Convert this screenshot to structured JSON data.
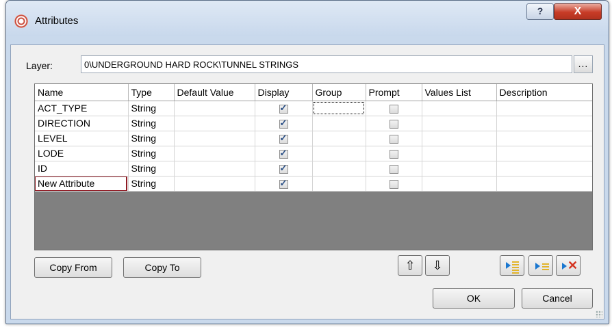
{
  "window": {
    "title": "Attributes",
    "help_label": "?",
    "close_label": "X"
  },
  "layer": {
    "label": "Layer:",
    "value": "0\\UNDERGROUND HARD ROCK\\TUNNEL STRINGS",
    "browse_label": "..."
  },
  "table": {
    "columns": [
      "Name",
      "Type",
      "Default Value",
      "Display",
      "Group",
      "Prompt",
      "Values List",
      "Description"
    ],
    "rows": [
      {
        "name": "ACT_TYPE",
        "type": "String",
        "default": "",
        "display": true,
        "group": "",
        "prompt": false,
        "values_list": "",
        "description": ""
      },
      {
        "name": "DIRECTION",
        "type": "String",
        "default": "",
        "display": true,
        "group": "",
        "prompt": false,
        "values_list": "",
        "description": ""
      },
      {
        "name": "LEVEL",
        "type": "String",
        "default": "",
        "display": true,
        "group": "",
        "prompt": false,
        "values_list": "",
        "description": ""
      },
      {
        "name": "LODE",
        "type": "String",
        "default": "",
        "display": true,
        "group": "",
        "prompt": false,
        "values_list": "",
        "description": ""
      },
      {
        "name": "ID",
        "type": "String",
        "default": "",
        "display": true,
        "group": "",
        "prompt": false,
        "values_list": "",
        "description": ""
      },
      {
        "name": "New Attribute",
        "type": "String",
        "default": "",
        "display": true,
        "group": "",
        "prompt": false,
        "values_list": "",
        "description": ""
      }
    ]
  },
  "buttons": {
    "copy_from": "Copy From",
    "copy_to": "Copy To",
    "move_up": "⇧",
    "move_down": "⇩",
    "ok": "OK",
    "cancel": "Cancel"
  },
  "icons": {
    "insert_row": "insert-row-icon",
    "append_row": "append-row-icon",
    "delete_row": "delete-row-icon"
  },
  "colors": {
    "highlight": "#8e1b24",
    "close": "#c73b26",
    "checkmark": "#2a4f86"
  }
}
